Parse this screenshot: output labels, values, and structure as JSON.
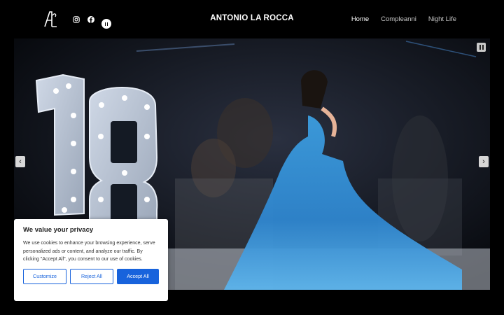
{
  "header": {
    "logo_text": "AL",
    "site_title": "ANTONIO LA ROCCA",
    "social_icons": [
      "instagram-icon",
      "facebook-icon"
    ],
    "pause_icon": "pause-icon",
    "nav": [
      {
        "label": "Home",
        "active": true
      },
      {
        "label": "Compleanni",
        "active": false
      },
      {
        "label": "Night Life",
        "active": false
      }
    ]
  },
  "hero": {
    "image_numbers": "18",
    "pause_icon": "pause-icon",
    "prev_icon": "chevron-left-icon",
    "next_icon": "chevron-right-icon",
    "prev_glyph": "‹",
    "next_glyph": "›"
  },
  "cookie": {
    "title": "We value your privacy",
    "body": "We use cookies to enhance your browsing experience, serve personalized ads or content, and analyze our traffic. By clicking \"Accept All\", you consent to our use of cookies.",
    "customize": "Customize",
    "reject": "Reject All",
    "accept": "Accept All",
    "accent_color": "#1863dc"
  }
}
